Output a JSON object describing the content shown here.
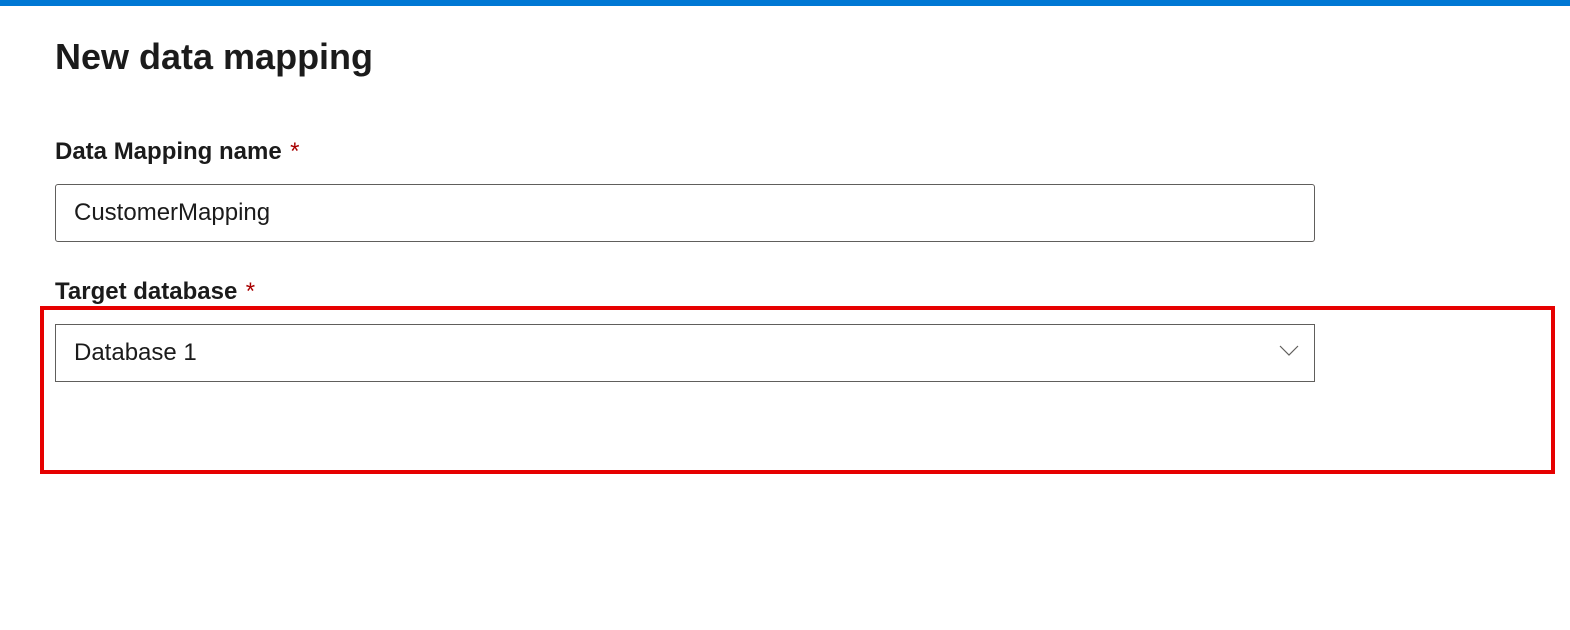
{
  "header": {
    "title": "New data mapping"
  },
  "form": {
    "name_field": {
      "label": "Data Mapping name",
      "required_marker": "*",
      "value": "CustomerMapping"
    },
    "target_field": {
      "label": "Target database",
      "required_marker": "*",
      "value": "Database 1"
    }
  },
  "colors": {
    "accent": "#0078d4",
    "highlight_border": "#e60000",
    "required": "#a80000"
  }
}
